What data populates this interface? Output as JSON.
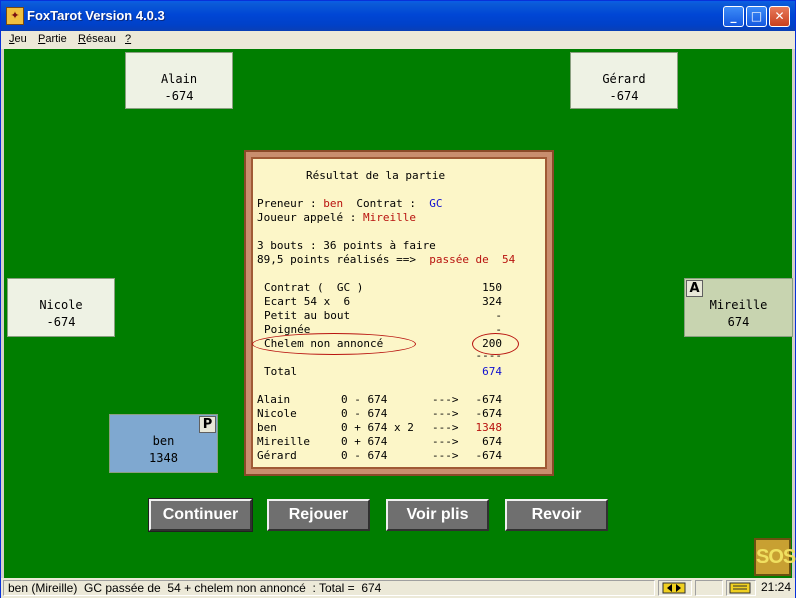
{
  "window": {
    "title": "FoxTarot Version 4.0.3",
    "controls": {
      "minimize": "_",
      "maximize": "□",
      "close": "✕"
    }
  },
  "menu": [
    {
      "label": "Jeu",
      "accel": "J",
      "rest": "eu"
    },
    {
      "label": "Partie",
      "accel": "P",
      "rest": "artie"
    },
    {
      "label": "Réseau",
      "accel": "R",
      "rest": "éseau"
    },
    {
      "label": "?",
      "accel": "?",
      "rest": ""
    }
  ],
  "players": {
    "alain": {
      "name": "Alain",
      "score": "-674"
    },
    "gerard": {
      "name": "Gérard",
      "score": "-674"
    },
    "nicole": {
      "name": "Nicole",
      "score": "-674"
    },
    "mireille": {
      "name": "Mireille",
      "score": "674",
      "badge": "A"
    },
    "ben": {
      "name": "ben",
      "score": "1348",
      "badge": "P"
    }
  },
  "result": {
    "title": "Résultat de la partie",
    "preneur_label": "Preneur :",
    "preneur": "ben",
    "contrat_label": "Contrat :",
    "contrat": "GC",
    "appele_label": "Joueur appelé :",
    "appele": "Mireille",
    "bouts": "3 bouts : 36 points à faire",
    "realises": "89,5 points réalisés ==>",
    "passee": "passée de  54",
    "lines": [
      {
        "label": "Contrat (  GC )",
        "value": "150"
      },
      {
        "label": "Ecart 54 x  6",
        "value": "324"
      },
      {
        "label": "Petit au bout",
        "value": "-"
      },
      {
        "label": "Poignée",
        "value": "-"
      },
      {
        "label": "Chelem non annoncé",
        "value": "200"
      }
    ],
    "separator": "----",
    "total_label": "Total",
    "total_value": "674",
    "scores": [
      {
        "name": "Alain",
        "calc": "0 - 674",
        "arrow": "--->",
        "value": "-674"
      },
      {
        "name": "Nicole",
        "calc": "0 - 674",
        "arrow": "--->",
        "value": "-674"
      },
      {
        "name": "ben",
        "calc": "0 + 674 x 2",
        "arrow": "--->",
        "value": "1348"
      },
      {
        "name": "Mireille",
        "calc": "0 + 674",
        "arrow": "--->",
        "value": "674"
      },
      {
        "name": "Gérard",
        "calc": "0 - 674",
        "arrow": "--->",
        "value": "-674"
      }
    ]
  },
  "buttons": {
    "continuer": "Continuer",
    "rejouer": "Rejouer",
    "voir_plis": "Voir plis",
    "revoir": "Revoir"
  },
  "sos": "SOS",
  "status": {
    "text": "ben (Mireille)  GC passée de  54 + chelem non annoncé  : Total =  674",
    "clock": "21:24"
  },
  "colors": {
    "table_green": "#007e00",
    "highlight_red": "#b8120e",
    "contract_blue": "#1010d0",
    "dialog_bg": "#fcf6c8",
    "button_gray": "#6f6f6f",
    "taker_plate": "#7fa8d0",
    "partner_plate": "#c8d4b0"
  }
}
